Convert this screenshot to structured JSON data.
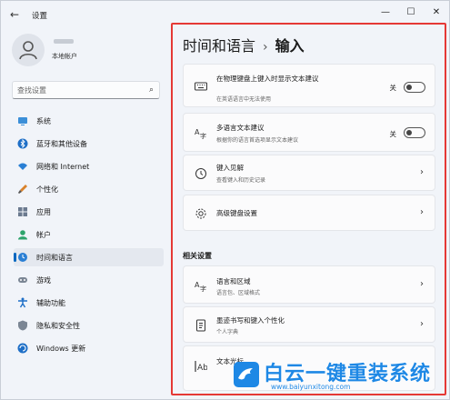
{
  "window": {
    "title": "设置"
  },
  "profile": {
    "account_type": "本地帐户"
  },
  "search": {
    "placeholder": "查找设置"
  },
  "sidebar": {
    "items": [
      {
        "label": "系统",
        "icon": "monitor-icon"
      },
      {
        "label": "蓝牙和其他设备",
        "icon": "bluetooth-icon"
      },
      {
        "label": "网络和 Internet",
        "icon": "wifi-icon"
      },
      {
        "label": "个性化",
        "icon": "brush-icon"
      },
      {
        "label": "应用",
        "icon": "apps-icon"
      },
      {
        "label": "帐户",
        "icon": "person-icon"
      },
      {
        "label": "时间和语言",
        "icon": "globe-clock-icon",
        "active": true
      },
      {
        "label": "游戏",
        "icon": "gamepad-icon"
      },
      {
        "label": "辅助功能",
        "icon": "accessibility-icon"
      },
      {
        "label": "隐私和安全性",
        "icon": "shield-icon"
      },
      {
        "label": "Windows 更新",
        "icon": "update-icon"
      }
    ]
  },
  "breadcrumb": {
    "parent": "时间和语言",
    "separator": "›",
    "current": "输入"
  },
  "cards": [
    {
      "title": "在物理键盘上键入时显示文本建议",
      "subtitle": "在英语语言中无法使用",
      "state_label": "关",
      "toggle_on": false,
      "icon": "keyboard-icon"
    },
    {
      "title": "多语言文本建议",
      "subtitle": "根据你的语言首选项显示文本建议",
      "state_label": "关",
      "toggle_on": false,
      "icon": "language-icon"
    },
    {
      "title": "键入见解",
      "subtitle": "查看键入和历史记录",
      "icon": "history-icon"
    },
    {
      "title": "高级键盘设置",
      "subtitle": "",
      "icon": "gear-icon"
    }
  ],
  "related": {
    "heading": "相关设置",
    "cards": [
      {
        "title": "语言和区域",
        "subtitle": "语言包、区域格式",
        "icon": "language-region-icon"
      },
      {
        "title": "墨迹书写和键入个性化",
        "subtitle": "个人字典",
        "icon": "notebook-icon"
      },
      {
        "title": "文本光标",
        "subtitle": "",
        "icon": "text-cursor-icon"
      }
    ]
  },
  "watermark": {
    "text": "白云一键重装系统",
    "url": "www.baiyunxitong.com"
  },
  "colors": {
    "accent": "#0067c0",
    "highlight": "#e53935",
    "watermark": "#1e88e5"
  }
}
